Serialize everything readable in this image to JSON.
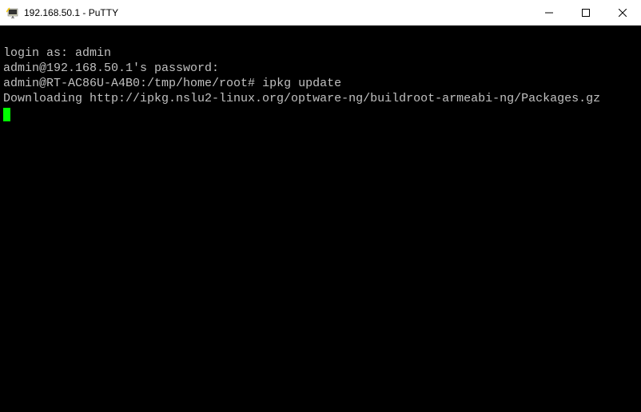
{
  "window": {
    "title": "192.168.50.1 - PuTTY"
  },
  "terminal": {
    "line1_prompt": "login as: ",
    "line1_input": "admin",
    "line2": "admin@192.168.50.1's password:",
    "line3_prompt": "admin@RT-AC86U-A4B0:/tmp/home/root# ",
    "line3_cmd": "ipkg update",
    "line4": "Downloading http://ipkg.nslu2-linux.org/optware-ng/buildroot-armeabi-ng/Packages.gz"
  }
}
